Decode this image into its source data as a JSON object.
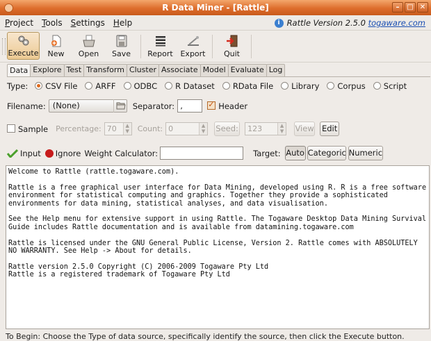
{
  "window": {
    "title": "R Data Miner - [Rattle]",
    "minimize": "–",
    "maximize": "□",
    "close": "✕"
  },
  "menu": {
    "items": [
      "Project",
      "Tools",
      "Settings",
      "Help"
    ],
    "underline": [
      "P",
      "T",
      "S",
      "H"
    ]
  },
  "version": {
    "prefix": "Rattle Version 2.5.0 ",
    "link": "togaware.com"
  },
  "toolbar": {
    "execute": "Execute",
    "new": "New",
    "open": "Open",
    "save": "Save",
    "report": "Report",
    "export": "Export",
    "quit": "Quit"
  },
  "tabs": [
    "Data",
    "Explore",
    "Test",
    "Transform",
    "Cluster",
    "Associate",
    "Model",
    "Evaluate",
    "Log"
  ],
  "active_tab": "Data",
  "type_row": {
    "label": "Type:",
    "options": [
      "CSV File",
      "ARFF",
      "ODBC",
      "R Dataset",
      "RData File",
      "Library",
      "Corpus",
      "Script"
    ],
    "selected": "CSV File"
  },
  "file_row": {
    "filename_label": "Filename:",
    "filename_value": "(None)",
    "separator_label": "Separator:",
    "separator_value": ",",
    "header_label": "Header",
    "header_checked": true
  },
  "sample_row": {
    "sample_label": "Sample",
    "percentage_label": "Percentage:",
    "percentage_value": "70",
    "count_label": "Count:",
    "count_value": "0",
    "seed_button": "Seed:",
    "seed_value": "123",
    "view_button": "View",
    "edit_button": "Edit"
  },
  "role_row": {
    "input_label": "Input",
    "ignore_label": "Ignore",
    "weight_label": "Weight Calculator:",
    "target_label": "Target:",
    "auto_button": "Auto",
    "categoric_button": "Categoric",
    "numeric_button": "Numeric"
  },
  "textview": "Welcome to Rattle (rattle.togaware.com).\n\nRattle is a free graphical user interface for Data Mining, developed using R. R is a free software\nenvironment for statistical computing and graphics. Together they provide a sophisticated\nenvironments for data mining, statistical analyses, and data visualisation.\n\nSee the Help menu for extensive support in using Rattle. The Togaware Desktop Data Mining Survival\nGuide includes Rattle documentation and is available from datamining.togaware.com\n\nRattle is licensed under the GNU General Public License, Version 2. Rattle comes with ABSOLUTELY\nNO WARRANTY. See Help -> About for details.\n\nRattle version 2.5.0 Copyright (C) 2006-2009 Togaware Pty Ltd\nRattle is a registered trademark of Togaware Pty Ltd",
  "status": "To Begin: Choose the Type of data source, specifically identify the source, then click the Execute button.",
  "colors": {
    "accent": "#dd6d2c",
    "link": "#1b4fb3",
    "radio_on": "#e06a1c"
  }
}
